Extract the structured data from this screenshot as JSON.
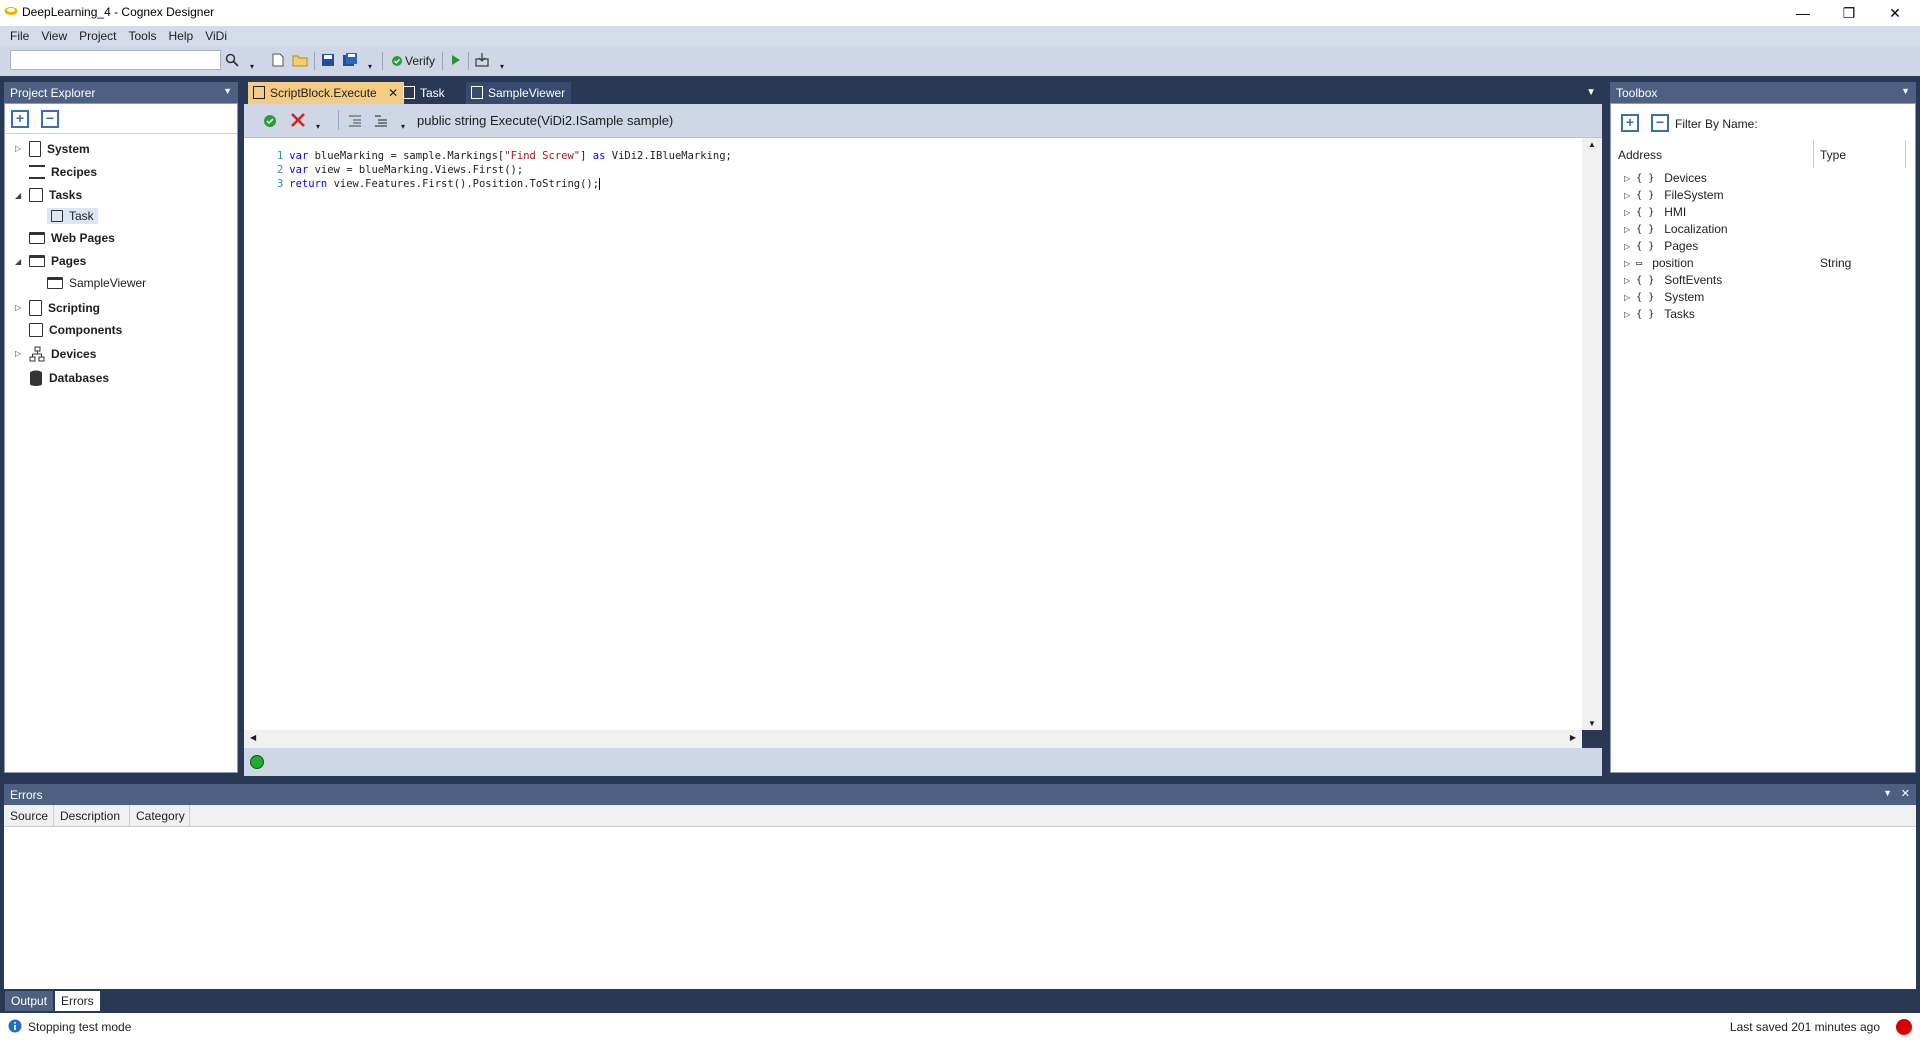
{
  "window": {
    "title": "DeepLearning_4 - Cognex Designer",
    "minimize": "—",
    "restore": "❐",
    "close": "✕"
  },
  "menu": [
    "File",
    "View",
    "Project",
    "Tools",
    "Help",
    "ViDi"
  ],
  "toolbar": {
    "search_value": "",
    "verify_label": "Verify"
  },
  "project_explorer": {
    "title": "Project Explorer",
    "items": [
      {
        "label": "System",
        "icon": "system-icon"
      },
      {
        "label": "Recipes",
        "icon": "recipes-icon"
      },
      {
        "label": "Tasks",
        "icon": "tasks-icon"
      },
      {
        "label": "Task",
        "icon": "task-icon"
      },
      {
        "label": "Web Pages",
        "icon": "webpages-icon"
      },
      {
        "label": "Pages",
        "icon": "pages-icon"
      },
      {
        "label": "SampleViewer",
        "icon": "page-icon"
      },
      {
        "label": "Scripting",
        "icon": "scripting-icon"
      },
      {
        "label": "Components",
        "icon": "components-icon"
      },
      {
        "label": "Devices",
        "icon": "devices-icon"
      },
      {
        "label": "Databases",
        "icon": "database-icon"
      }
    ]
  },
  "editor": {
    "tabs": [
      {
        "label": "ScriptBlock.Execute",
        "active": true
      },
      {
        "label": "Task",
        "active": false
      },
      {
        "label": "SampleViewer",
        "active": false
      }
    ],
    "signature": "public string Execute(ViDi2.ISample sample)",
    "code": [
      {
        "n": "1",
        "segments": [
          {
            "t": "var ",
            "c": "kw"
          },
          {
            "t": "blueMarking = sample.Markings[",
            "c": ""
          },
          {
            "t": "\"Find Screw\"",
            "c": "str"
          },
          {
            "t": "] ",
            "c": ""
          },
          {
            "t": "as",
            "c": "kw"
          },
          {
            "t": " ViDi2.IBlueMarking;",
            "c": ""
          }
        ]
      },
      {
        "n": "2",
        "segments": [
          {
            "t": "var ",
            "c": "kw"
          },
          {
            "t": "view = blueMarking.Views.First();",
            "c": ""
          }
        ]
      },
      {
        "n": "3",
        "segments": [
          {
            "t": "return ",
            "c": "kw"
          },
          {
            "t": "view.Features.First().Position.ToString();",
            "c": ""
          }
        ]
      }
    ],
    "status_color": "#22aa33"
  },
  "toolbox": {
    "title": "Toolbox",
    "filter_label": "Filter By Name:",
    "filter_value": "",
    "col_address": "Address",
    "col_type": "Type",
    "rows": [
      {
        "label": "Devices",
        "type": ""
      },
      {
        "label": "FileSystem",
        "type": ""
      },
      {
        "label": "HMI",
        "type": ""
      },
      {
        "label": "Localization",
        "type": ""
      },
      {
        "label": "Pages",
        "type": ""
      },
      {
        "label": "position",
        "type": "String"
      },
      {
        "label": "SoftEvents",
        "type": ""
      },
      {
        "label": "System",
        "type": ""
      },
      {
        "label": "Tasks",
        "type": ""
      }
    ]
  },
  "errors": {
    "title": "Errors",
    "columns": [
      "Source",
      "Description",
      "Category"
    ]
  },
  "bottom_tabs": [
    {
      "label": "Output",
      "active": false
    },
    {
      "label": "Errors",
      "active": true
    }
  ],
  "statusbar": {
    "message": "Stopping test mode",
    "last_saved": "Last saved 201 minutes ago",
    "indicator_color": "#dd0000"
  },
  "colors": {
    "chrome": "#293955",
    "panel_header": "#4d6082",
    "active_tab": "#f5cc84"
  }
}
